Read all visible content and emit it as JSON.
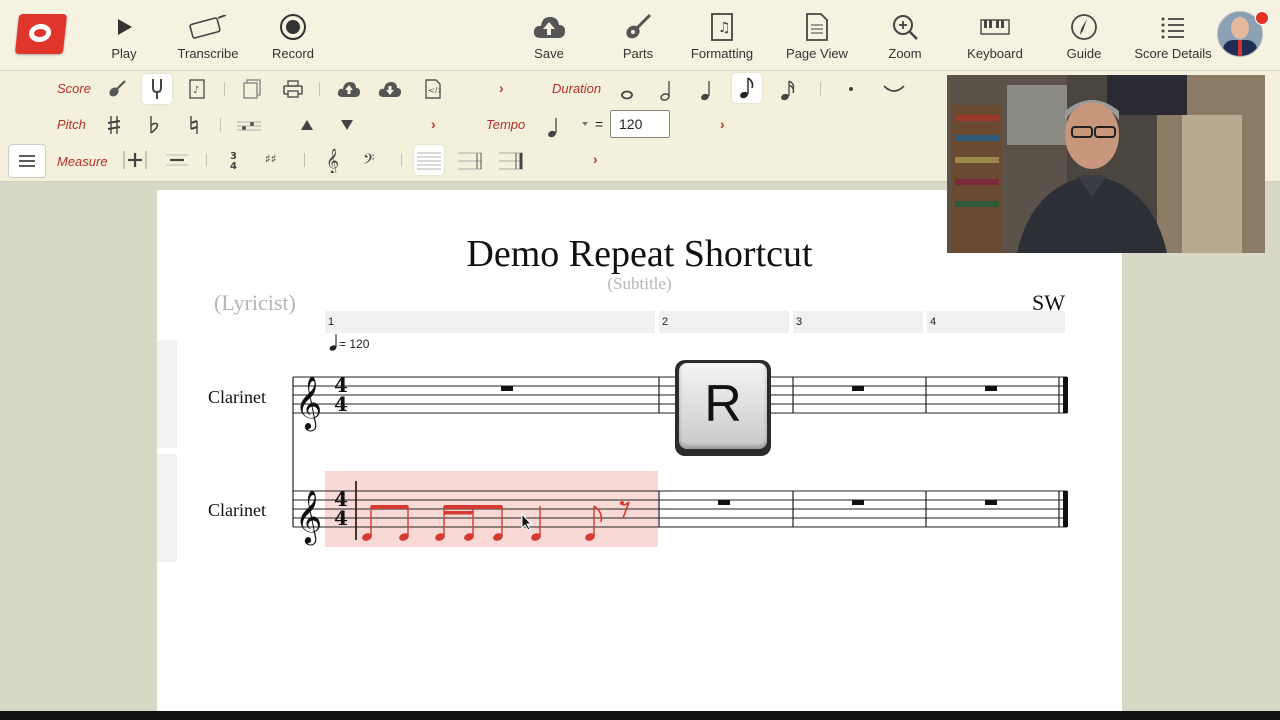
{
  "toolbar": {
    "buttons": [
      {
        "id": "play",
        "label": "Play",
        "icon": "play-icon"
      },
      {
        "id": "transcribe",
        "label": "Transcribe",
        "icon": "keyboard-pen-icon"
      },
      {
        "id": "record",
        "label": "Record",
        "icon": "record-icon"
      },
      {
        "id": "save",
        "label": "Save",
        "icon": "cloud-upload-icon"
      },
      {
        "id": "parts",
        "label": "Parts",
        "icon": "guitar-icon"
      },
      {
        "id": "formatting",
        "label": "Formatting",
        "icon": "music-doc-icon"
      },
      {
        "id": "pageview",
        "label": "Page View",
        "icon": "page-icon"
      },
      {
        "id": "zoom",
        "label": "Zoom",
        "icon": "zoom-in-icon"
      },
      {
        "id": "keyboard",
        "label": "Keyboard",
        "icon": "piano-icon"
      },
      {
        "id": "guide",
        "label": "Guide",
        "icon": "compass-icon"
      },
      {
        "id": "scoredetails",
        "label": "Score Details",
        "icon": "list-icon"
      }
    ]
  },
  "ribbon": {
    "score_label": "Score",
    "pitch_label": "Pitch",
    "measure_label": "Measure",
    "duration_label": "Duration",
    "tempo_label": "Tempo",
    "tempo_value": "120",
    "tempo_equals": "=",
    "chevron": "›"
  },
  "score": {
    "title": "Demo Repeat Shortcut",
    "subtitle": "(Subtitle)",
    "lyricist": "(Lyricist)",
    "composer": "SW",
    "measure_numbers": [
      "1",
      "2",
      "3",
      "4"
    ],
    "tempo_marking": "= 120",
    "time_signature": "4",
    "instruments": [
      "Clarinet",
      "Clarinet"
    ]
  },
  "overlay": {
    "key_label": "R"
  },
  "colors": {
    "accent": "#c0392b",
    "selection": "#f9d9d6",
    "note_red": "#d43a2f"
  }
}
